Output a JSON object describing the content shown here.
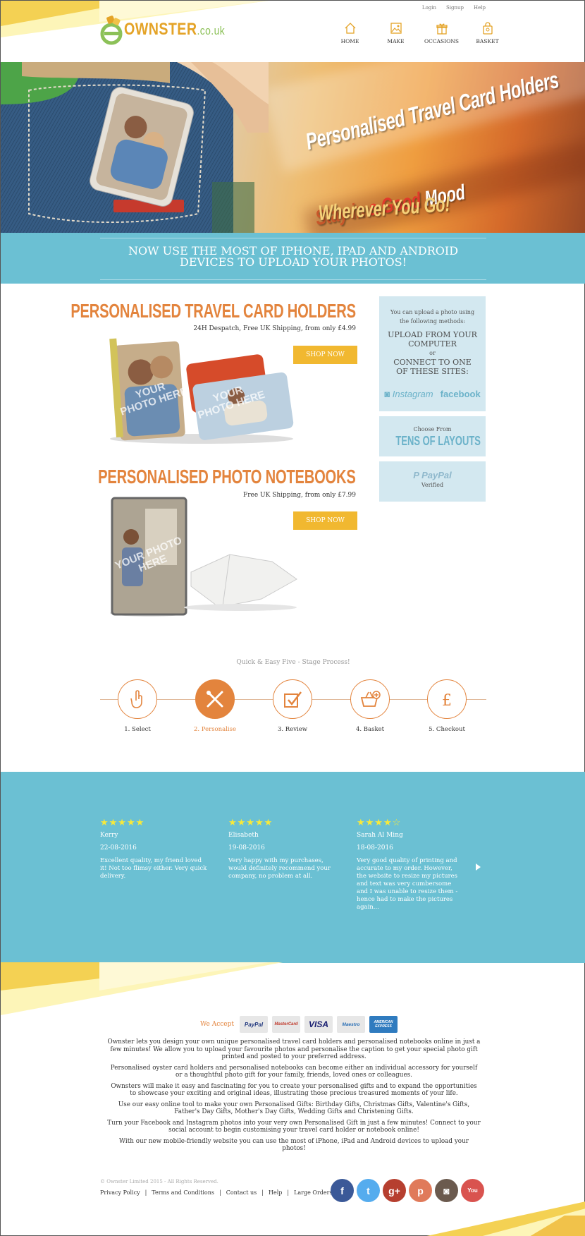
{
  "header": {
    "links": [
      "Login",
      "Signup",
      "Help"
    ],
    "logo": {
      "main": "OWNSTER",
      "suffix": ".co.uk"
    },
    "nav": [
      {
        "label": "HOME",
        "icon": "home-icon"
      },
      {
        "label": "MAKE",
        "icon": "image-icon"
      },
      {
        "label": "OCCASIONS",
        "icon": "gift-icon"
      },
      {
        "label": "BASKET",
        "icon": "basket-icon"
      }
    ]
  },
  "hero": {
    "line1": "Personalised Travel Card Holders",
    "line2_a": "Stay in",
    "line2_b": "a",
    "line2_c": "Good",
    "line2_d": "Mood",
    "line3": "Wherever You Go!"
  },
  "banner": {
    "text": "Now use the most of iPhone, iPad and Android devices to upload your photos!"
  },
  "products": [
    {
      "title": "PERSONALISED TRAVEL CARD HOLDERS",
      "subtitle": "24H Despatch, Free UK Shipping, from only £4.99",
      "button": "SHOP NOW",
      "overlay": "YOUR PHOTO HERE"
    },
    {
      "title": "PERSONALISED PHOTO NOTEBOOKS",
      "subtitle": "Free UK Shipping, from only £7.99",
      "button": "SHOP NOW",
      "overlay": "YOUR PHOTO HERE"
    }
  ],
  "sidebar": {
    "upload_intro": "You can upload a photo using the following methods:",
    "upload_computer": "UPLOAD FROM YOUR COMPUTER",
    "or": "or",
    "connect": "CONNECT TO ONE OF THESE SITES:",
    "instagram": "Instagram",
    "facebook": "facebook",
    "choose_from": "Choose From",
    "layouts": "TENS OF LAYOUTS",
    "paypal": "PayPal",
    "verified": "Verified"
  },
  "process": {
    "title": "Quick & Easy Five - Stage Process!",
    "steps": [
      {
        "label": "1. Select",
        "icon": "hand-pointer-icon"
      },
      {
        "label": "2. Personalise",
        "icon": "tools-icon"
      },
      {
        "label": "3. Review",
        "icon": "checkbox-icon"
      },
      {
        "label": "4. Basket",
        "icon": "basket-add-icon"
      },
      {
        "label": "5. Checkout",
        "icon": "pound-icon"
      }
    ],
    "active_step": 2
  },
  "reviews": [
    {
      "stars": "★★★★★",
      "name": "Kerry",
      "date": "22-08-2016",
      "text": "Excellent quality, my friend loved it! Not too flimsy either. Very quick delivery."
    },
    {
      "stars": "★★★★★",
      "name": "Elisabeth",
      "date": "19-08-2016",
      "text": "Very happy with my purchases, would definitely recommend your company, no problem at all."
    },
    {
      "stars": "★★★★☆",
      "name": "Sarah Al Ming",
      "date": "18-08-2016",
      "text": "Very good quality of printing and accurate to my order. However, the website to resize my pictures and text was very cumbersome and I was unable to resize them - hence had to make the pictures again..."
    }
  ],
  "footer": {
    "we_accept": "We Accept",
    "cards": [
      "PayPal",
      "MasterCard",
      "VISA",
      "Maestro",
      "AMERICAN EXPRESS"
    ],
    "paragraphs": [
      "Ownster lets you design your own unique personalised travel card holders and personalised notebooks online in just a few minutes! We allow you to upload your favourite photos and personalise the caption to get your special photo gift printed and posted to your preferred address.",
      "Personalised oyster card holders and personalised notebooks can become either an individual accessory for yourself or a thoughtful photo gift for your family, friends, loved ones or colleagues.",
      "Ownsters will make it easy and fascinating for you to create your personalised gifts and to expand the opportunities to showcase your exciting and original ideas, illustrating those precious treasured moments of your life.",
      "Use our easy online tool to make your own Personalised Gifts: Birthday Gifts, Christmas Gifts, Valentine's Gifts, Father's Day Gifts, Mother's Day Gifts, Wedding Gifts and Christening Gifts.",
      "Turn your Facebook and Instagram photos into your very own Personalised Gift in just a few minutes! Connect to your social account to begin customising your travel card holder or notebook online!",
      "With our new mobile-friendly website you can use the most of iPhone, iPad and Android devices to upload your photos!"
    ],
    "copyright": "© Ownster Limited 2015 - All Rights Reserved.",
    "links": [
      "Privacy Policy",
      "Terms and Conditions",
      "Contact us",
      "Help",
      "Large Orders"
    ],
    "socials": [
      {
        "name": "facebook-icon",
        "glyph": "f",
        "color": "#3b5998"
      },
      {
        "name": "twitter-icon",
        "glyph": "t",
        "color": "#55acee"
      },
      {
        "name": "google-plus-icon",
        "glyph": "g+",
        "color": "#b63f2f"
      },
      {
        "name": "pinterest-icon",
        "glyph": "p",
        "color": "#e07a5a"
      },
      {
        "name": "instagram-icon",
        "glyph": "◙",
        "color": "#6b5a4e"
      },
      {
        "name": "youtube-icon",
        "glyph": "You",
        "color": "#d9534f"
      }
    ]
  },
  "colors": {
    "accent": "#e3843d",
    "blue": "#6bc0d3",
    "yellow": "#f1b830"
  }
}
